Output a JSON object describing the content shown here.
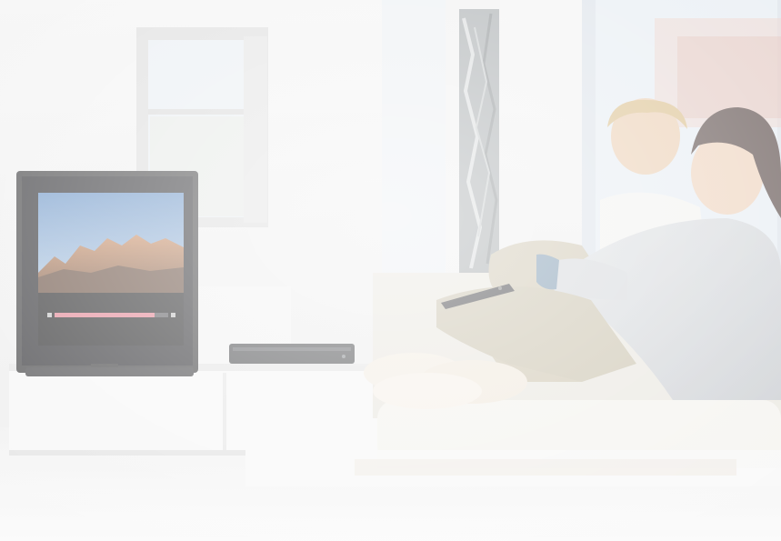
{
  "scene": {
    "palette": {
      "wall": "#ededed",
      "floor": "#f4f4f4",
      "window_sky": "#dde8f2",
      "sofa": "#f1efe9",
      "tv_frame": "#2e2e30",
      "screen_sky": "#6f96c4",
      "screen_rock": "#b07040",
      "progress_bar": "#e07888",
      "knit_sweater": "#cfd2d6",
      "trousers": "#c9c0a8",
      "hair_man": "#d6b77f",
      "hair_woman": "#4a3a36"
    },
    "tv": {
      "progress_fraction": 0.88
    }
  }
}
